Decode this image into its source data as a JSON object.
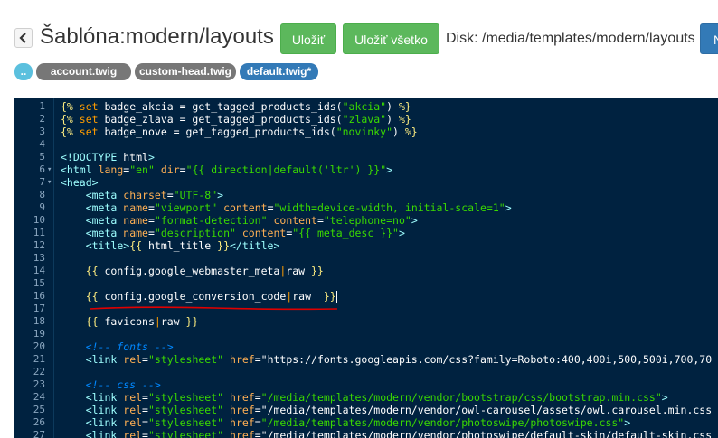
{
  "header": {
    "title": "Šablóna:modern/layouts",
    "save_label": "Uložiť",
    "save_all_label": "Uložiť všetko",
    "disk_label": "Disk: /media/templates/modern/layouts",
    "blue_button_label": "N"
  },
  "tabs": [
    {
      "label": ".."
    },
    {
      "label": "account.twig"
    },
    {
      "label": "custom-head.twig"
    },
    {
      "label": "default.twig*"
    }
  ],
  "colors": {
    "accent_green": "#5cb85c",
    "accent_blue": "#337ab7",
    "editor_bg": "#002240",
    "annotation_red": "#e00000"
  },
  "editor": {
    "lines": [
      {
        "n": "1",
        "fold": "",
        "text": "{% set badge_akcia = get_tagged_products_ids(\"akcia\") %}"
      },
      {
        "n": "2",
        "fold": "",
        "text": "{% set badge_zlava = get_tagged_products_ids(\"zlava\") %}"
      },
      {
        "n": "3",
        "fold": "",
        "text": "{% set badge_nove = get_tagged_products_ids(\"novinky\") %}"
      },
      {
        "n": "4",
        "fold": "",
        "text": ""
      },
      {
        "n": "5",
        "fold": "",
        "text": "<!DOCTYPE html>"
      },
      {
        "n": "6",
        "fold": "▾",
        "text": "<html lang=\"en\" dir=\"{{ direction|default('ltr') }}\">"
      },
      {
        "n": "7",
        "fold": "▾",
        "text": "<head>"
      },
      {
        "n": "8",
        "fold": "",
        "text": "    <meta charset=\"UTF-8\">"
      },
      {
        "n": "9",
        "fold": "",
        "text": "    <meta name=\"viewport\" content=\"width=device-width, initial-scale=1\">"
      },
      {
        "n": "10",
        "fold": "",
        "text": "    <meta name=\"format-detection\" content=\"telephone=no\">"
      },
      {
        "n": "11",
        "fold": "",
        "text": "    <meta name=\"description\" content=\"{{ meta_desc }}\">"
      },
      {
        "n": "12",
        "fold": "",
        "text": "    <title>{{ html_title }}</title>"
      },
      {
        "n": "13",
        "fold": "",
        "text": ""
      },
      {
        "n": "14",
        "fold": "",
        "text": "    {{ config.google_webmaster_meta|raw }}"
      },
      {
        "n": "15",
        "fold": "",
        "text": ""
      },
      {
        "n": "16",
        "fold": "",
        "text": "    {{ config.google_conversion_code|raw  }}"
      },
      {
        "n": "17",
        "fold": "",
        "text": ""
      },
      {
        "n": "18",
        "fold": "",
        "text": "    {{ favicons|raw }}"
      },
      {
        "n": "19",
        "fold": "",
        "text": ""
      },
      {
        "n": "20",
        "fold": "",
        "text": "    <!-- fonts -->"
      },
      {
        "n": "21",
        "fold": "",
        "text": "    <link rel=\"stylesheet\" href=\"https://fonts.googleapis.com/css?family=Roboto:400,400i,500,500i,700,70"
      },
      {
        "n": "22",
        "fold": "",
        "text": ""
      },
      {
        "n": "23",
        "fold": "",
        "text": "    <!-- css -->"
      },
      {
        "n": "24",
        "fold": "",
        "text": "    <link rel=\"stylesheet\" href=\"/media/templates/modern/vendor/bootstrap/css/bootstrap.min.css\">"
      },
      {
        "n": "25",
        "fold": "",
        "text": "    <link rel=\"stylesheet\" href=\"/media/templates/modern/vendor/owl-carousel/assets/owl.carousel.min.css"
      },
      {
        "n": "26",
        "fold": "",
        "text": "    <link rel=\"stylesheet\" href=\"/media/templates/modern/vendor/photoswipe/photoswipe.css\">"
      },
      {
        "n": "27",
        "fold": "",
        "text": "    <link rel=\"stylesheet\" href=\"/media/templates/modern/vendor/photoswipe/default-skin/default-skin.css"
      }
    ]
  }
}
